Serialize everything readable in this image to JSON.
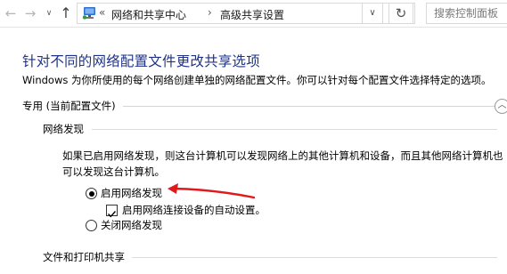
{
  "nav": {
    "back_glyph": "←",
    "forward_glyph": "→",
    "recent_glyph": "∨",
    "up_glyph": "↑",
    "breadcrumb_separator": "«",
    "crumb_sep2": "›",
    "breadcrumb": [
      "网络和共享中心",
      "高级共享设置"
    ],
    "dropdown_glyph": "∨",
    "refresh_glyph": "↻",
    "search_placeholder": "搜索控制面板"
  },
  "main": {
    "title": "针对不同的网络配置文件更改共享选项",
    "description": "Windows 为你所使用的每个网络创建单独的网络配置文件。你可以针对每个配置文件选择特定的选项。",
    "profile": {
      "label": "专用 (当前配置文件)",
      "collapse_glyph": "︿"
    },
    "network_discovery": {
      "heading": "网络发现",
      "description": "如果已启用网络发现，则这台计算机可以发现网络上的其他计算机和设备，而且其他网络计算机也可以发现这台计算机。",
      "option_on": "启用网络发现",
      "auto_setup": "启用网络连接设备的自动设置。",
      "option_off": "关闭网络发现",
      "selected": "on",
      "auto_setup_checked": true
    },
    "file_printer_sharing": {
      "heading": "文件和打印机共享"
    }
  },
  "colors": {
    "title": "#1e3287",
    "annotation_arrow": "#e0191c"
  },
  "icons": {
    "address": "network-folder-icon",
    "annotation": "red-arrow-annotation"
  }
}
